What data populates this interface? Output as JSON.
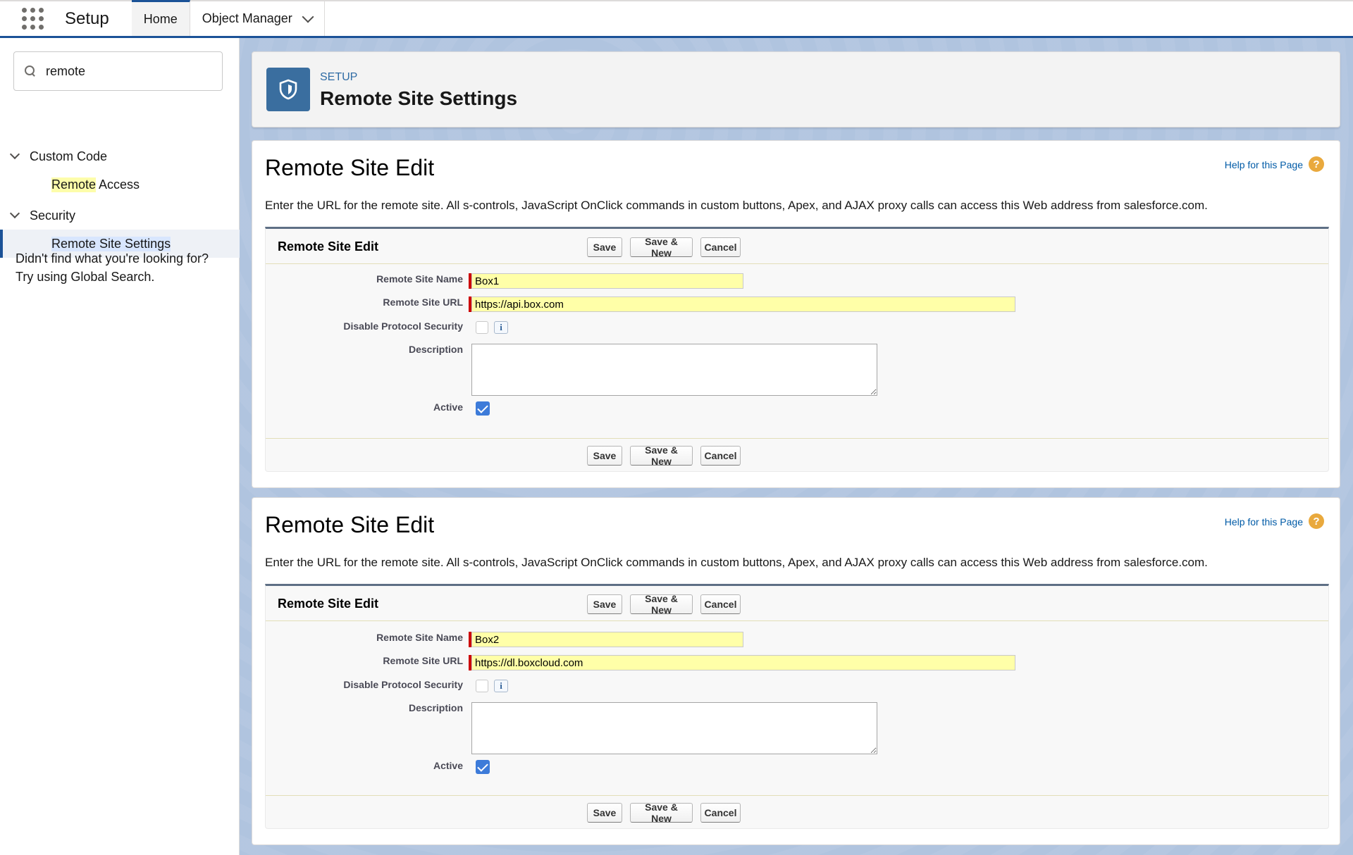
{
  "app": {
    "name": "Setup",
    "tabs": [
      {
        "label": "Home"
      },
      {
        "label": "Object Manager"
      }
    ]
  },
  "sidebar": {
    "search_value": "remote",
    "sections": [
      {
        "label": "Custom Code",
        "item_highlight": "Remote",
        "item_rest": " Access"
      },
      {
        "label": "Security",
        "item_label": "Remote Site Settings"
      }
    ],
    "not_found": "Didn't find what you're looking for? Try using Global Search."
  },
  "header": {
    "eyebrow": "SETUP",
    "title": "Remote Site Settings"
  },
  "forms": [
    {
      "title": "Remote Site Edit",
      "help_link": "Help for this Page",
      "intro": "Enter the URL for the remote site. All s-controls, JavaScript OnClick commands in custom buttons, Apex, and AJAX proxy calls can access this Web address from salesforce.com.",
      "block_title": "Remote Site Edit",
      "buttons": {
        "save": "Save",
        "save_new": "Save & New",
        "cancel": "Cancel"
      },
      "labels": {
        "name": "Remote Site Name",
        "url": "Remote Site URL",
        "disable": "Disable Protocol Security",
        "description": "Description",
        "active": "Active"
      },
      "values": {
        "name": "Box1",
        "url": "https://api.box.com",
        "description": ""
      }
    },
    {
      "title": "Remote Site Edit",
      "help_link": "Help for this Page",
      "intro": "Enter the URL for the remote site. All s-controls, JavaScript OnClick commands in custom buttons, Apex, and AJAX proxy calls can access this Web address from salesforce.com.",
      "block_title": "Remote Site Edit",
      "buttons": {
        "save": "Save",
        "save_new": "Save & New",
        "cancel": "Cancel"
      },
      "labels": {
        "name": "Remote Site Name",
        "url": "Remote Site URL",
        "disable": "Disable Protocol Security",
        "description": "Description",
        "active": "Active"
      },
      "values": {
        "name": "Box2",
        "url": "https://dl.boxcloud.com",
        "description": ""
      }
    }
  ],
  "icons": {
    "help": "?",
    "info": "i"
  }
}
